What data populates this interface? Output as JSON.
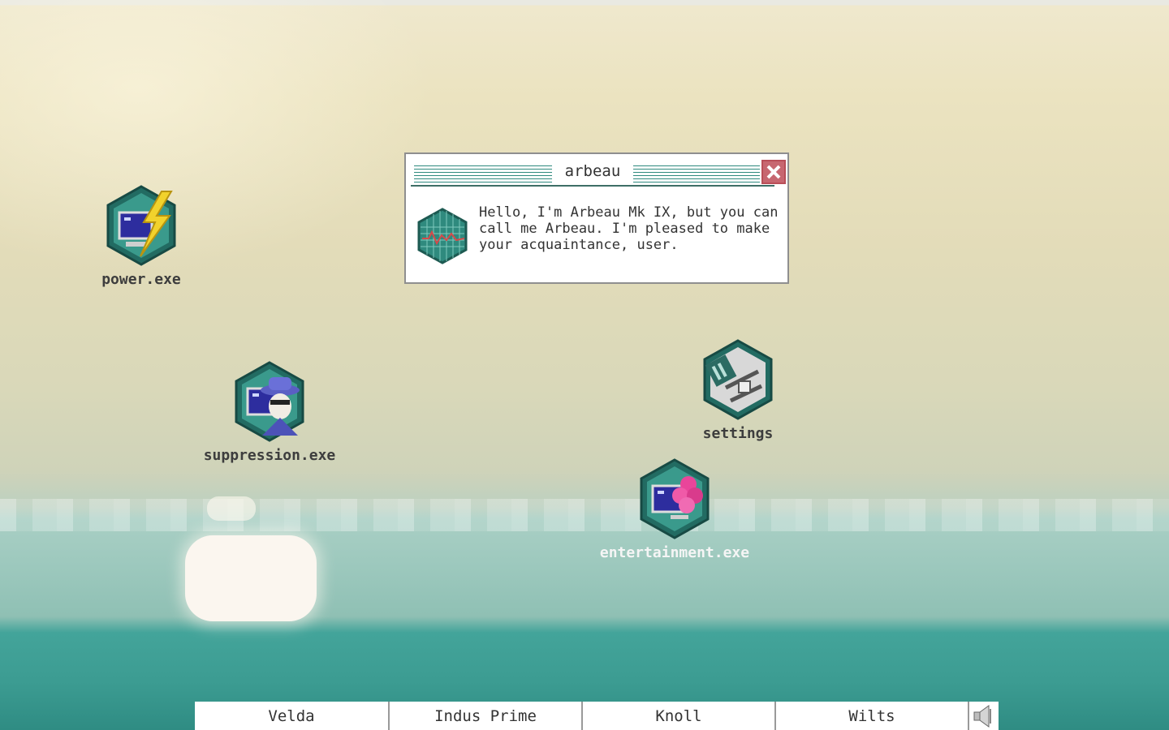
{
  "desktop": {
    "icons": [
      {
        "label": "power.exe",
        "icon": "power-icon"
      },
      {
        "label": "suppression.exe",
        "icon": "suppression-icon"
      },
      {
        "label": "settings",
        "icon": "settings-icon"
      },
      {
        "label": "entertainment.exe",
        "icon": "entertainment-icon"
      }
    ]
  },
  "dialog": {
    "title": "arbeau",
    "message": "Hello, I'm Arbeau Mk IX, but you can call me Arbeau. I'm pleased to make your acquaintance, user.",
    "close_icon": "close-icon",
    "avatar_icon": "arbeau-avatar-icon"
  },
  "taskbar": {
    "tabs": [
      "Velda",
      "Indus Prime",
      "Knoll",
      "Wilts"
    ],
    "sound_icon": "speaker-icon"
  },
  "colors": {
    "teal": "#2e8a7e",
    "close_red": "#c76770",
    "text": "#333333"
  }
}
